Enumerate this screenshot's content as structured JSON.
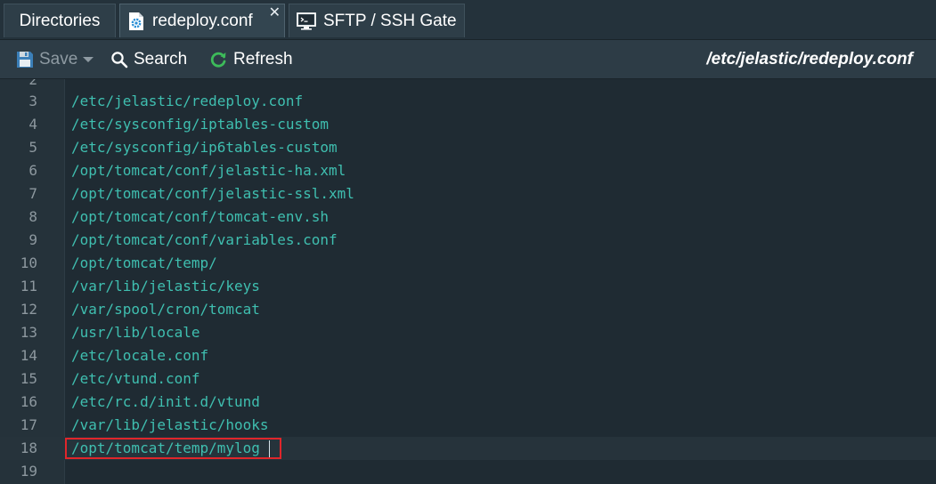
{
  "tabs": [
    {
      "label": "Directories"
    },
    {
      "label": "redeploy.conf",
      "close_glyph": "✕"
    },
    {
      "label": "SFTP / SSH Gate"
    }
  ],
  "toolbar": {
    "save_label": "Save",
    "search_label": "Search",
    "refresh_label": "Refresh",
    "file_path": "/etc/jelastic/redeploy.conf"
  },
  "editor": {
    "lines": [
      {
        "num": "2",
        "text": ""
      },
      {
        "num": "3",
        "text": "/etc/jelastic/redeploy.conf"
      },
      {
        "num": "4",
        "text": "/etc/sysconfig/iptables-custom"
      },
      {
        "num": "5",
        "text": "/etc/sysconfig/ip6tables-custom"
      },
      {
        "num": "6",
        "text": "/opt/tomcat/conf/jelastic-ha.xml"
      },
      {
        "num": "7",
        "text": "/opt/tomcat/conf/jelastic-ssl.xml"
      },
      {
        "num": "8",
        "text": "/opt/tomcat/conf/tomcat-env.sh"
      },
      {
        "num": "9",
        "text": "/opt/tomcat/conf/variables.conf"
      },
      {
        "num": "10",
        "text": "/opt/tomcat/temp/"
      },
      {
        "num": "11",
        "text": "/var/lib/jelastic/keys"
      },
      {
        "num": "12",
        "text": "/var/spool/cron/tomcat"
      },
      {
        "num": "13",
        "text": "/usr/lib/locale"
      },
      {
        "num": "14",
        "text": "/etc/locale.conf"
      },
      {
        "num": "15",
        "text": "/etc/vtund.conf"
      },
      {
        "num": "16",
        "text": "/etc/rc.d/init.d/vtund"
      },
      {
        "num": "17",
        "text": "/var/lib/jelastic/hooks"
      },
      {
        "num": "18",
        "text": "/opt/tomcat/temp/mylog"
      },
      {
        "num": "19",
        "text": ""
      }
    ],
    "current_line": "18"
  },
  "colors": {
    "code_text": "#3fbfb0",
    "line_numbers": "#8d989f",
    "highlight_border": "#e0262b",
    "refresh_icon": "#3dbb5a"
  },
  "icons": {
    "file_tab": "gear-file-icon",
    "sftp_tab": "terminal-icon",
    "save": "floppy-disk-icon",
    "search": "magnifier-icon",
    "refresh": "refresh-icon"
  }
}
